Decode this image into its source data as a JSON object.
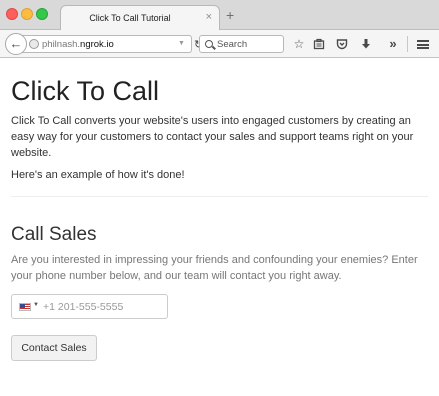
{
  "browser": {
    "tab_title": "Click To Call Tutorial",
    "tab_close": "×",
    "new_tab": "+",
    "url_prefix": "philnash.",
    "url_domain": "ngrok.io",
    "search_placeholder": "Search",
    "icons": [
      "back-arrow",
      "globe",
      "dropdown-caret",
      "reload",
      "search",
      "bookmark-star",
      "reading-list",
      "pocket",
      "download",
      "overflow-chevrons",
      "hamburger-menu"
    ]
  },
  "page": {
    "title": "Click To Call",
    "intro": "Click To Call converts your website's users into engaged customers by creating an easy way for your customers to contact your sales and support teams right on your website.",
    "example": "Here's an example of how it's done!",
    "section": {
      "title": "Call Sales",
      "description": "Are you interested in impressing your friends and confounding your enemies? Enter your phone number below, and our team will contact you right away.",
      "phone_placeholder": "+1 201-555-5555",
      "country": "US",
      "button_label": "Contact Sales"
    }
  },
  "colors": {
    "close_red": "#fc605c",
    "minimize_yellow": "#fdbc40",
    "zoom_green": "#34c84a",
    "text": "#333333",
    "muted_text": "#777777"
  }
}
